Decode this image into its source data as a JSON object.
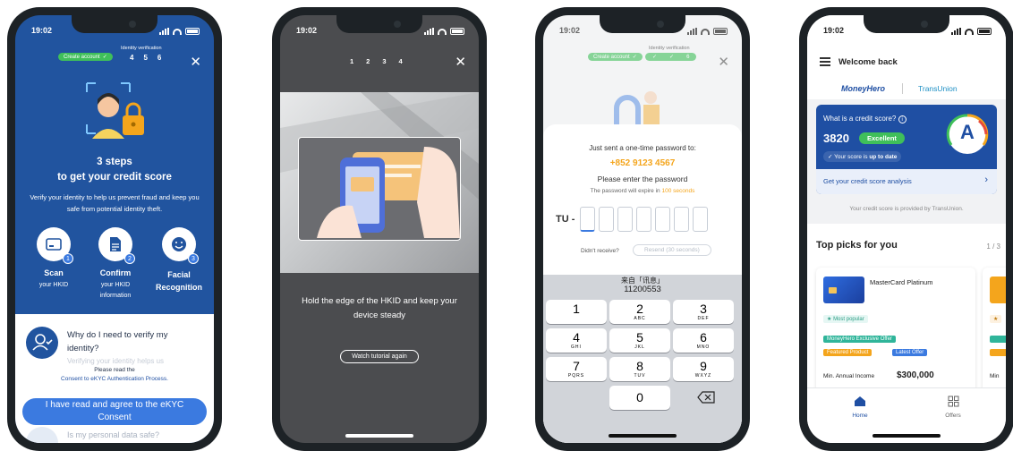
{
  "phone1": {
    "time": "19:02",
    "progress_pill": "Create account",
    "progress_title": "Identity verification",
    "progress_steps": [
      "4",
      "5",
      "6"
    ],
    "title_line1": "3 steps",
    "title_line2": "to get your credit score",
    "description": "Verify your identity to help us prevent fraud and keep you safe from potential identity theft.",
    "steps": [
      {
        "badge": "1",
        "title": "Scan",
        "subtitle": "your HKID"
      },
      {
        "badge": "2",
        "title": "Confirm",
        "subtitle": "your HKID information"
      },
      {
        "badge": "3",
        "title": "Facial Recognition",
        "subtitle": ""
      }
    ],
    "faq1": "Why do I need to verify my identity?",
    "faq1_faded": "Verifying your identity helps us",
    "consent_prefix": "Please read the",
    "consent_link": "Consent to eKYC Authentication Process.",
    "agree_button": "I have read and agree to the eKYC Consent",
    "faq2": "Is my personal data safe?"
  },
  "phone2": {
    "time": "19:02",
    "steps": [
      "1",
      "2",
      "3",
      "4"
    ],
    "instruction": "Hold the edge of the HKID and keep your device steady",
    "tutorial_button": "Watch tutorial again"
  },
  "phone3": {
    "time": "19:02",
    "progress_pill": "Create account",
    "progress_title": "Identity verification",
    "progress_last": "6",
    "sent_text": "Just sent a one-time password to:",
    "phone_number": "+852 9123 4567",
    "enter_text": "Please enter the password",
    "expire_prefix": "The password will expire in",
    "expire_value": "100 seconds",
    "otp_prefix": "TU -",
    "didnt_receive": "Didn't receive?",
    "resend": "Resend (30 seconds)",
    "sms_from": "来自「讯息」",
    "sms_code": "11200553",
    "keys": [
      {
        "d": "1",
        "l": ""
      },
      {
        "d": "2",
        "l": "ABC"
      },
      {
        "d": "3",
        "l": "DEF"
      },
      {
        "d": "4",
        "l": "GHI"
      },
      {
        "d": "5",
        "l": "JKL"
      },
      {
        "d": "6",
        "l": "MNO"
      },
      {
        "d": "7",
        "l": "PQRS"
      },
      {
        "d": "8",
        "l": "TUV"
      },
      {
        "d": "9",
        "l": "WXYZ"
      },
      {
        "d": "0",
        "l": ""
      }
    ]
  },
  "phone4": {
    "time": "19:02",
    "welcome": "Welcome back",
    "brand1": "MoneyHero",
    "brand2": "TransUnion",
    "score_question": "What is a credit score?",
    "score_value": "3820",
    "score_rating": "Excellent",
    "score_grade": "A",
    "score_status_prefix": "Your score is",
    "score_status_value": "up to date",
    "analysis_link": "Get your credit score analysis",
    "provided_by": "Your credit score is provided by TransUnion.",
    "top_picks": "Top picks for you",
    "page_indicator": "1 / 3",
    "card_name": "MasterCard Platinum",
    "most_popular": "Most popular",
    "tag_exclusive": "MoneyHero Exclusive Offer",
    "tag_featured": "Featured Product",
    "tag_latest": "Latest Offer",
    "min_income_label": "Min. Annual Income",
    "min_income_value": "$300,000",
    "min_income_partial": "Min",
    "tab_home": "Home",
    "tab_offers": "Offers"
  },
  "colors": {
    "primary_blue": "#21549f",
    "accent_blue": "#3b7ae0",
    "green": "#3fbf5a",
    "orange": "#f4a51c"
  }
}
